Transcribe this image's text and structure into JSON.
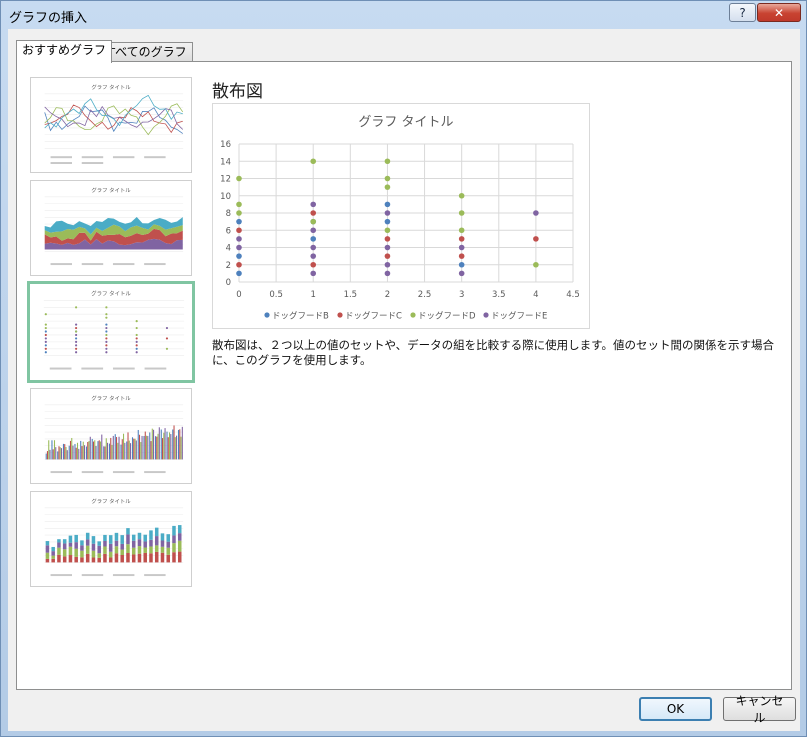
{
  "window": {
    "title": "グラフの挿入",
    "help_label": "?",
    "close_label": "✕"
  },
  "tabs": [
    {
      "label": "おすすめグラフ",
      "active": true
    },
    {
      "label": "すべてのグラフ",
      "active": false
    }
  ],
  "thumbnails": [
    {
      "type": "line",
      "title": "グラフ タイトル"
    },
    {
      "type": "stacked-area",
      "title": "グラフ タイトル"
    },
    {
      "type": "scatter",
      "title": "グラフ タイトル",
      "selected": true
    },
    {
      "type": "clustered-column",
      "title": "グラフ タイトル"
    },
    {
      "type": "stacked-column",
      "title": "グラフ タイトル"
    }
  ],
  "preview": {
    "heading": "散布図",
    "description": "散布図は、２つ以上の値のセットや、データの組を比較する際に使用します。値のセット間の関係を示す場合に、このグラフを使用します。"
  },
  "chart_data": {
    "type": "scatter",
    "title": "グラフ タイトル",
    "xlim": [
      0,
      4.5
    ],
    "ylim": [
      0,
      16
    ],
    "xticks": [
      0,
      0.5,
      1,
      1.5,
      2,
      2.5,
      3,
      3.5,
      4,
      4.5
    ],
    "yticks": [
      0,
      2,
      4,
      6,
      8,
      10,
      12,
      14,
      16
    ],
    "grid": true,
    "legend_position": "bottom",
    "series": [
      {
        "name": "ドッグフードB",
        "color": "#4e81bd",
        "points": [
          [
            0,
            1
          ],
          [
            0,
            3
          ],
          [
            0,
            7
          ],
          [
            1,
            5
          ],
          [
            1,
            7
          ],
          [
            2,
            7
          ],
          [
            2,
            9
          ],
          [
            3,
            2
          ]
        ]
      },
      {
        "name": "ドッグフードC",
        "color": "#c0504d",
        "points": [
          [
            0,
            2
          ],
          [
            0,
            6
          ],
          [
            1,
            2
          ],
          [
            1,
            8
          ],
          [
            2,
            3
          ],
          [
            2,
            5
          ],
          [
            3,
            3
          ],
          [
            3,
            5
          ],
          [
            4,
            5
          ]
        ]
      },
      {
        "name": "ドッグフードD",
        "color": "#9bbb59",
        "points": [
          [
            0,
            12
          ],
          [
            0,
            9
          ],
          [
            0,
            8
          ],
          [
            1,
            14
          ],
          [
            1,
            7
          ],
          [
            2,
            14
          ],
          [
            2,
            12
          ],
          [
            2,
            11
          ],
          [
            2,
            6
          ],
          [
            3,
            10
          ],
          [
            3,
            8
          ],
          [
            3,
            6
          ],
          [
            4,
            2
          ]
        ]
      },
      {
        "name": "ドッグフードE",
        "color": "#8064a2",
        "points": [
          [
            0,
            4
          ],
          [
            0,
            5
          ],
          [
            1,
            1
          ],
          [
            1,
            3
          ],
          [
            1,
            4
          ],
          [
            1,
            6
          ],
          [
            1,
            9
          ],
          [
            2,
            1
          ],
          [
            2,
            2
          ],
          [
            2,
            4
          ],
          [
            2,
            8
          ],
          [
            3,
            1
          ],
          [
            3,
            4
          ],
          [
            4,
            8
          ]
        ]
      }
    ]
  },
  "buttons": {
    "ok": "OK",
    "cancel": "キャンセル"
  }
}
